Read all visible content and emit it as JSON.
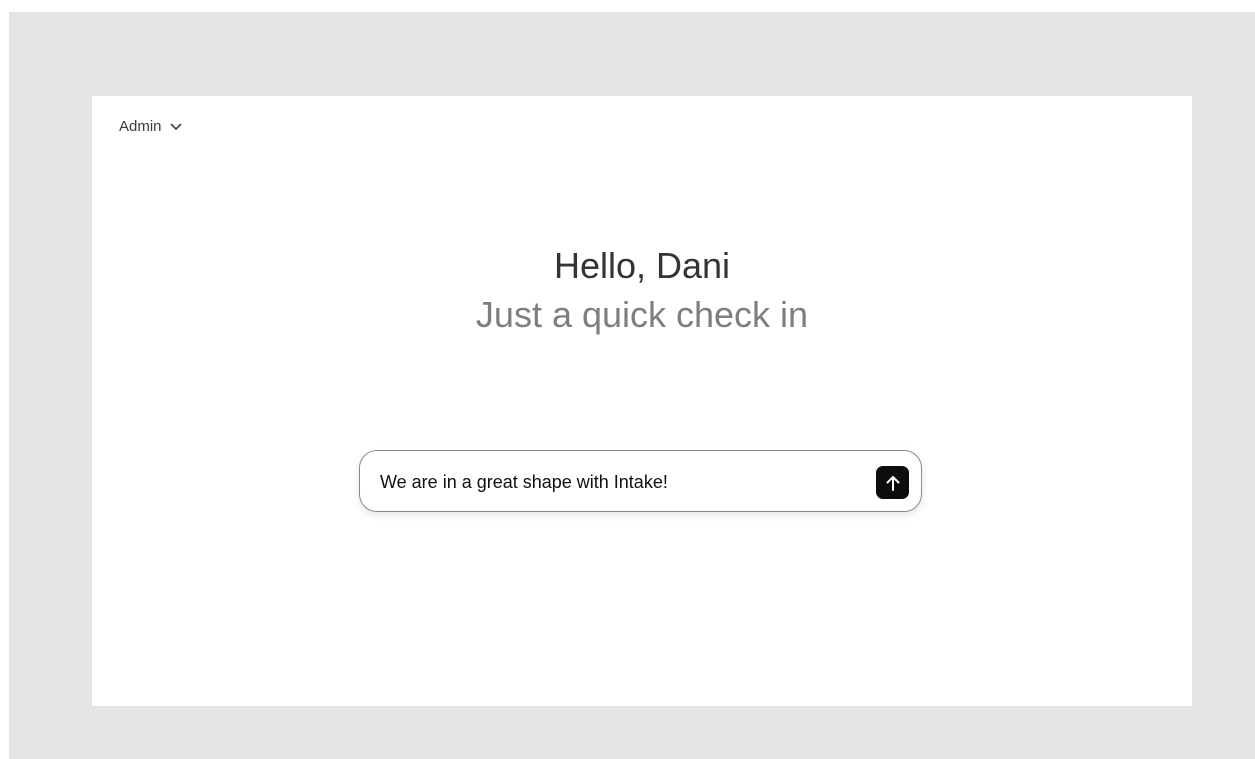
{
  "header": {
    "role_label": "Admin",
    "role_icon": "chevron-down-icon"
  },
  "hero": {
    "greeting": "Hello, Dani",
    "subtitle": "Just a quick check in"
  },
  "prompt": {
    "value": "We are in a great shape with Intake!",
    "send_icon": "arrow-up-icon"
  },
  "colors": {
    "backdrop": "#e3e4e6",
    "card": "#ffffff",
    "greeting_text": "#343434",
    "subtitle_text": "#7e7e7e",
    "send_button": "#0d0d0d"
  }
}
